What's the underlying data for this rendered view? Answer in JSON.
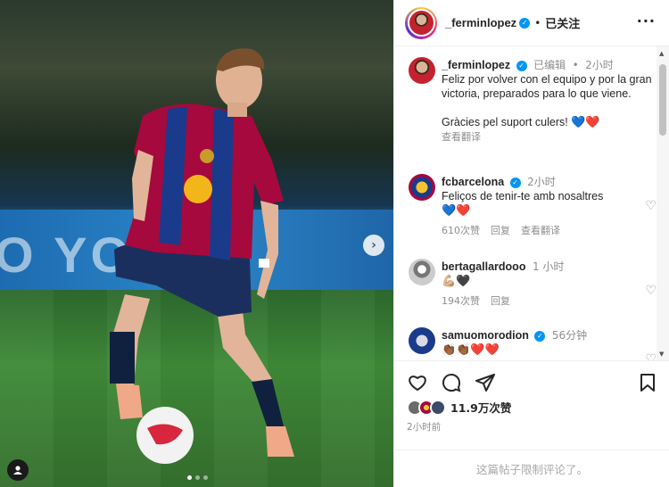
{
  "post": {
    "username": "_ferminlopez",
    "follow_label": "已关注",
    "more_label": "···",
    "image": {
      "banner_text": "O YO",
      "next_label": "›",
      "carousel_count": 3,
      "carousel_active": 1
    },
    "caption": {
      "username": "_ferminlopez",
      "edited": "已编辑",
      "time": "2小时",
      "text": "Feliz por volver con el equipo y por la gran victoria, preparados para lo que viene.",
      "text2": "Gràcies pel suport culers!",
      "text2_emoji": "💙❤️",
      "translate": "查看翻译"
    },
    "comments": [
      {
        "username": "fcbarcelona",
        "verified": true,
        "time": "2小时",
        "text": "Feliços de tenir-te amb nosaltres",
        "emoji": "💙❤️",
        "likes": "610次赞",
        "reply": "回复",
        "translate": "查看翻译"
      },
      {
        "username": "bertagallardooo",
        "verified": false,
        "time": "1 小时",
        "text": "",
        "emoji": "💪🏼🖤",
        "likes": "194次赞",
        "reply": "回复"
      },
      {
        "username": "samuomorodion",
        "verified": true,
        "time": "56分钟",
        "text": "",
        "emoji": "👏🏾👏🏾❤️❤️",
        "likes": "",
        "reply": ""
      }
    ],
    "likes_text": "11.9万次赞",
    "posted_ago": "2小时前",
    "comments_limited": "这篇帖子限制评论了。"
  },
  "colors": {
    "verified": "#0095f6",
    "barca_blue": "#1a3a8c",
    "barca_red": "#a6093d"
  },
  "icons": [
    "heart-icon",
    "comment-icon",
    "share-icon",
    "bookmark-icon",
    "verified-icon",
    "more-icon",
    "user-icon"
  ]
}
